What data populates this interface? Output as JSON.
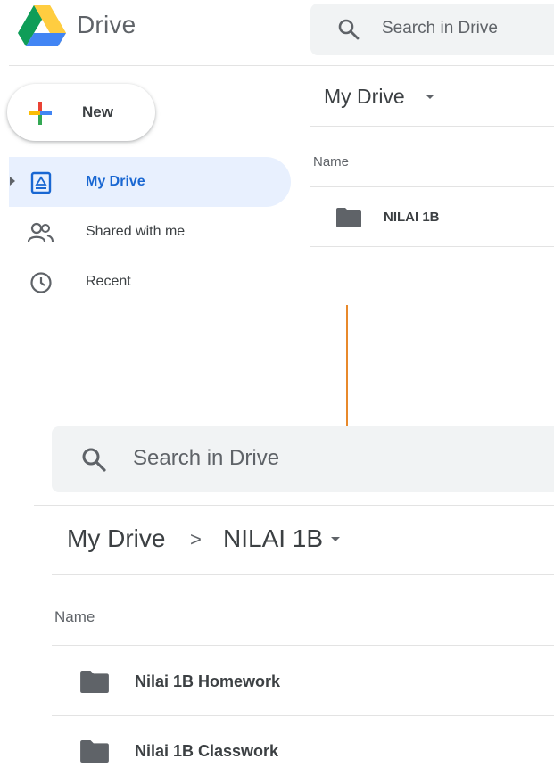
{
  "app": {
    "title": "Drive"
  },
  "search": {
    "placeholder": "Search in Drive"
  },
  "new_button": {
    "label": "New"
  },
  "sidebar": {
    "items": [
      {
        "label": "My Drive",
        "icon": "my-drive-icon",
        "active": true
      },
      {
        "label": "Shared with me",
        "icon": "people-icon",
        "active": false
      },
      {
        "label": "Recent",
        "icon": "clock-icon",
        "active": false
      }
    ]
  },
  "top_view": {
    "location": "My Drive",
    "column_name": "Name",
    "rows": [
      {
        "name": "NILAI 1B",
        "icon": "folder-icon"
      }
    ]
  },
  "bottom_view": {
    "breadcrumb": [
      "My Drive",
      "NILAI 1B"
    ],
    "breadcrumb_separator": ">",
    "column_name": "Name",
    "rows": [
      {
        "name": "Nilai 1B Homework",
        "icon": "folder-icon"
      },
      {
        "name": "Nilai 1B Classwork",
        "icon": "folder-icon"
      }
    ]
  },
  "colors": {
    "accent_arrow": "#e8892b",
    "active_nav_bg": "#e8f0fe",
    "active_nav_text": "#1967d2",
    "search_bg": "#f1f3f4"
  }
}
